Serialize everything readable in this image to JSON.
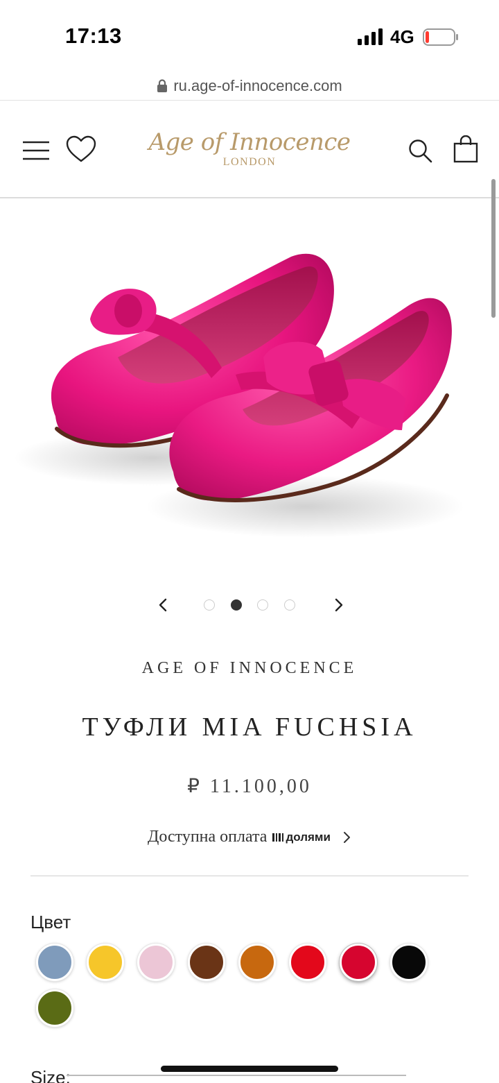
{
  "status_bar": {
    "time": "17:13",
    "network": "4G"
  },
  "browser": {
    "url": "ru.age-of-innocence.com"
  },
  "header": {
    "logo_script": "Age of Innocence",
    "logo_sub": "LONDON",
    "logo_color": "#b89a6a"
  },
  "carousel": {
    "slide_count": 4,
    "active_index": 1
  },
  "product": {
    "brand": "AGE OF INNOCENCE",
    "title": "ТУФЛИ MIA FUCHSIA",
    "price": "₽ 11.100,00",
    "installment_text": "Доступна оплата",
    "installment_provider": "долями",
    "image_alt": "Fuchsia velvet Mary Jane shoes with bow",
    "main_color": "#e8157f"
  },
  "color_section": {
    "label": "Цвет",
    "swatches": [
      {
        "name": "blue",
        "hex": "#7f9bbb"
      },
      {
        "name": "yellow",
        "hex": "#f6c62a"
      },
      {
        "name": "pink",
        "hex": "#ecc6d6"
      },
      {
        "name": "brown",
        "hex": "#6a3416"
      },
      {
        "name": "orange",
        "hex": "#c7680f"
      },
      {
        "name": "red",
        "hex": "#e3081b"
      },
      {
        "name": "crimson",
        "hex": "#d6052f",
        "selected": true
      },
      {
        "name": "black",
        "hex": "#080808"
      },
      {
        "name": "olive",
        "hex": "#5a6b15"
      }
    ]
  },
  "size_section": {
    "label": "Size:"
  }
}
